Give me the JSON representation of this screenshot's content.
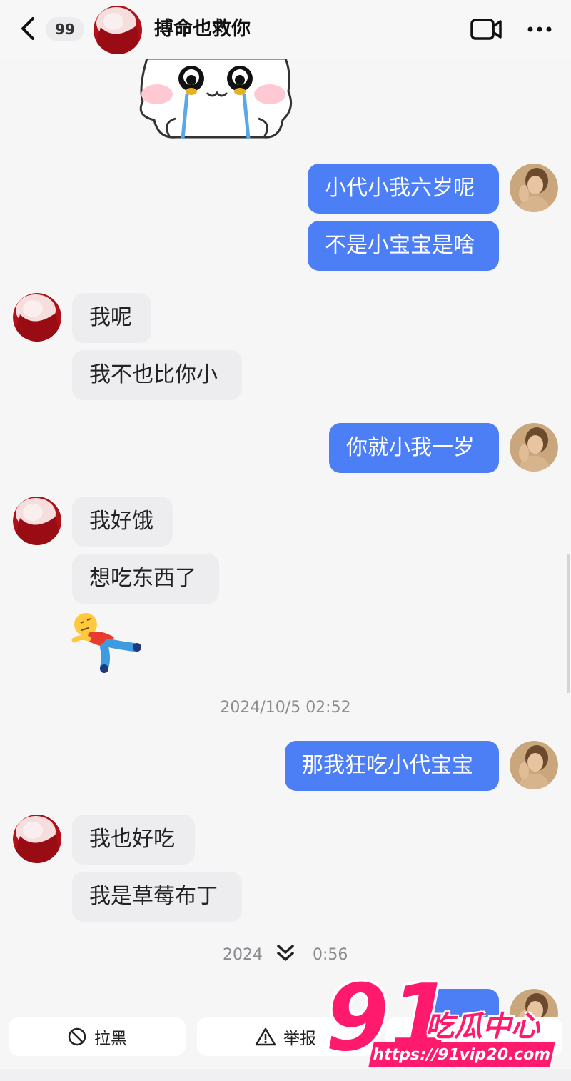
{
  "header": {
    "unread_count": "99",
    "contact_name": "搏命也救你"
  },
  "messages": {
    "out1": "小代小我六岁呢",
    "out2": "不是小宝宝是啥",
    "in1": "我呢",
    "in2": "我不也比你小",
    "out3": "你就小我一岁",
    "in3": "我好饿",
    "in4": "想吃东西了",
    "timestamp1": "2024/10/5 02:52",
    "out4": "那我狂吃小代宝宝",
    "in5": "我也好吃",
    "in6": "我是草莓布丁",
    "timestamp2_left": "2024",
    "timestamp2_right": "0:56"
  },
  "actions": {
    "block_label": "拉黑",
    "report_label": "举报"
  },
  "watermark": {
    "big": "91",
    "name": "吃瓜中心",
    "url": "https://91vip20.com"
  },
  "colors": {
    "outgoing_bubble": "#4c7ef5",
    "incoming_bubble": "#ededf0",
    "watermark": "#ff1a6d"
  },
  "icons": [
    "back-icon",
    "video-call-icon",
    "more-icon",
    "block-icon",
    "report-icon",
    "scroll-down-icon"
  ]
}
